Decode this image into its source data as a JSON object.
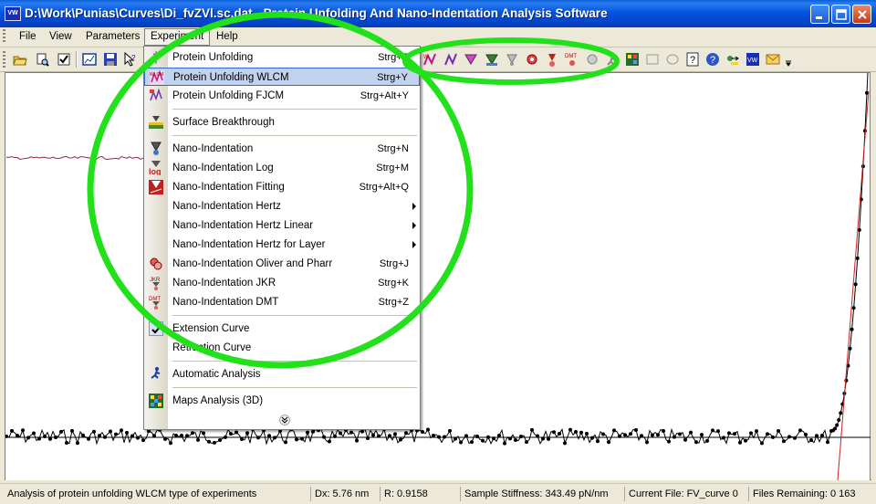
{
  "window": {
    "title": "D:\\Work\\Punias\\Curves\\Di_fvZVl.sc.dat - Protein Unfolding And Nano-Indentation Analysis Software",
    "icon_label": "VW"
  },
  "menubar": {
    "items": [
      "File",
      "View",
      "Parameters",
      "Experiment",
      "Help"
    ],
    "active": "Experiment"
  },
  "toolbar": {
    "icons": [
      "open-folder-icon",
      "print-preview-icon",
      "checklist-icon",
      "chart-window-icon",
      "save-icon",
      "pointer-help-icon",
      "unfold-wlc-icon",
      "unfold-fjc-icon",
      "nano-icon",
      "nano-log-icon",
      "nano-fit-icon",
      "oliver-pharr-icon",
      "jkr-icon",
      "dmt-icon",
      "hertz-icon",
      "maps-icon",
      "rectangle-icon",
      "ellipse-icon",
      "help-book-icon",
      "about-icon",
      "fetch-icon",
      "app-logo-icon",
      "mail-icon"
    ]
  },
  "experiment_menu": {
    "items": [
      {
        "label": "Protein Unfolding",
        "shortcut": "Strg+P",
        "icon": "protein-unfolding-icon"
      },
      {
        "label": "Protein Unfolding WLCM",
        "shortcut": "Strg+Y",
        "icon": "wlcm-icon",
        "highlighted": true
      },
      {
        "label": "Protein Unfolding FJCM",
        "shortcut": "Strg+Alt+Y",
        "icon": "fjcm-icon"
      },
      {
        "label": "Surface Breakthrough",
        "shortcut": "",
        "icon": "surface-breakthrough-icon"
      },
      {
        "label": "Nano-Indentation",
        "shortcut": "Strg+N",
        "icon": "nano-indentation-icon"
      },
      {
        "label": "Nano-Indentation Log",
        "shortcut": "Strg+M",
        "icon": "nano-log-icon"
      },
      {
        "label": "Nano-Indentation Fitting",
        "shortcut": "Strg+Alt+Q",
        "icon": "nano-fitting-icon"
      },
      {
        "label": "Nano-Indentation Hertz",
        "submenu": true
      },
      {
        "label": "Nano-Indentation Hertz Linear",
        "submenu": true
      },
      {
        "label": "Nano-Indentation Hertz for Layer",
        "submenu": true
      },
      {
        "label": "Nano-Indentation Oliver and Pharr",
        "shortcut": "Strg+J",
        "icon": "oliver-pharr-icon"
      },
      {
        "label": "Nano-Indentation JKR",
        "shortcut": "Strg+K",
        "icon": "jkr-icon"
      },
      {
        "label": "Nano-Indentation DMT",
        "shortcut": "Strg+Z",
        "icon": "dmt-icon"
      },
      {
        "label": "Extension Curve",
        "checked": true
      },
      {
        "label": "Retraction Curve"
      },
      {
        "label": "Automatic Analysis",
        "icon": "runner-icon"
      },
      {
        "label": "Maps Analysis (3D)",
        "icon": "maps-icon"
      }
    ],
    "icon_text": {
      "wlcm": "WLCM",
      "log": "log",
      "jkr": "JKR",
      "dmt": "DMT"
    }
  },
  "statusbar": {
    "message": "Analysis of protein unfolding WLCM type of experiments",
    "dx": "Dx: 5.76 nm",
    "r": "R: 0.9158",
    "stiffness": "Sample Stiffness: 343.49 pN/nm",
    "current_file": "Current File: FV_curve 0",
    "files_remaining": "Files Remaining: 0 163"
  },
  "colors": {
    "title_bar": "#0454de",
    "highlight": "#c1d2ee",
    "annotation": "#22e01a",
    "curve_black": "#000000",
    "curve_red": "#cc2222",
    "curve_maroon": "#8b2b3b"
  }
}
